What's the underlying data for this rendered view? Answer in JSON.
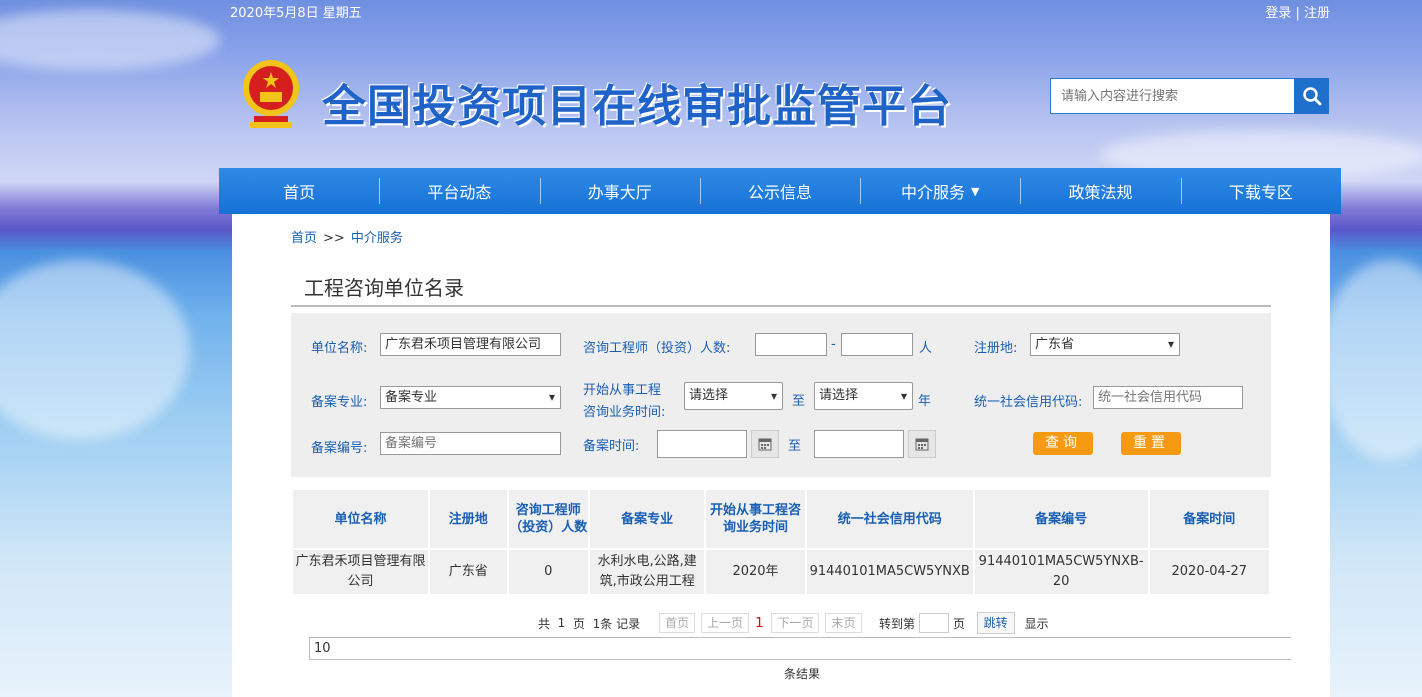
{
  "header": {
    "date": "2020年5月8日 星期五",
    "login": "登录",
    "auth_sep": "|",
    "register": "注册",
    "site_title": "全国投资项目在线审批监管平台",
    "search_placeholder": "请输入内容进行搜索"
  },
  "nav": {
    "items": [
      "首页",
      "平台动态",
      "办事大厅",
      "公示信息",
      "中介服务",
      "政策法规",
      "下载专区"
    ],
    "dropdown_caret": "▼"
  },
  "breadcrumb": {
    "home": "首页",
    "sep": ">>",
    "current": "中介服务"
  },
  "page_title": "工程咨询单位名录",
  "filter": {
    "unit_name_label": "单位名称:",
    "unit_name_value": "广东君禾项目管理有限公司",
    "engineer_count_label": "咨询工程师（投资）人数:",
    "range_sep": "-",
    "count_unit": "人",
    "region_label": "注册地:",
    "region_value": "广东省",
    "specialty_label": "备案专业:",
    "specialty_value": "备案专业",
    "start_time_label_1": "开始从事工程",
    "start_time_label_2": "咨询业务时间:",
    "start_from_value": "请选择",
    "to_label": "至",
    "start_to_value": "请选择",
    "year_unit": "年",
    "credit_code_label": "统一社会信用代码:",
    "credit_code_placeholder": "统一社会信用代码",
    "record_no_label": "备案编号:",
    "record_no_placeholder": "备案编号",
    "record_time_label": "备案时间:",
    "to_label_2": "至",
    "query_button": "查询",
    "reset_button": "重置"
  },
  "table": {
    "headers": [
      "单位名称",
      "注册地",
      "咨询工程师（投资）人数",
      "备案专业",
      "开始从事工程咨询业务时间",
      "统一社会信用代码",
      "备案编号",
      "备案时间"
    ],
    "rows": [
      [
        "广东君禾项目管理有限公司",
        "广东省",
        "0",
        "水利水电,公路,建筑,市政公用工程",
        "2020年",
        "91440101MA5CW5YNXB",
        "91440101MA5CW5YNXB-20",
        "2020-04-27"
      ]
    ]
  },
  "pager": {
    "total_prefix": "共",
    "total_pages": "1",
    "page_unit": "页",
    "total_records": "1条",
    "records_unit": "记录",
    "first": "首页",
    "prev": "上一页",
    "current": "1",
    "next": "下一页",
    "last": "末页",
    "goto_label": "转到第",
    "goto_unit": "页",
    "go_button": "跳转",
    "show_label": "显示",
    "page_size": "10",
    "size_suffix": "条结果"
  },
  "colors": {
    "nav": "#1671d6",
    "link": "#1a5fb4",
    "accent_button": "#f59a12"
  }
}
